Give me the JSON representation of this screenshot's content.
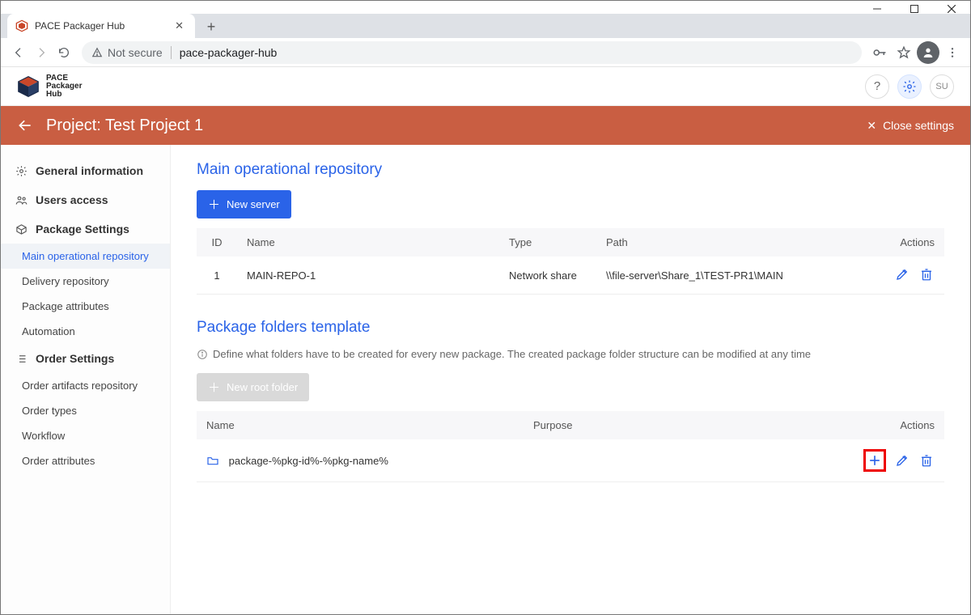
{
  "window": {
    "tab_title": "PACE Packager Hub",
    "not_secure_label": "Not secure",
    "url": "pace-packager-hub"
  },
  "app_header": {
    "logo_l1": "PACE",
    "logo_l2": "Packager",
    "logo_l3": "Hub",
    "user_badge": "SU"
  },
  "project_bar": {
    "title": "Project: Test Project 1",
    "close_label": "Close settings"
  },
  "sidebar": {
    "general": "General information",
    "users": "Users access",
    "pkg_settings": "Package Settings",
    "pkg_items": [
      "Main operational repository",
      "Delivery repository",
      "Package attributes",
      "Automation"
    ],
    "order_settings": "Order Settings",
    "order_items": [
      "Order artifacts repository",
      "Order types",
      "Workflow",
      "Order attributes"
    ]
  },
  "repo_section": {
    "title": "Main operational repository",
    "new_server_label": "New server",
    "columns": {
      "id": "ID",
      "name": "Name",
      "type": "Type",
      "path": "Path",
      "actions": "Actions"
    },
    "rows": [
      {
        "id": "1",
        "name": "MAIN-REPO-1",
        "type": "Network share",
        "path": "\\\\file-server\\Share_1\\TEST-PR1\\MAIN"
      }
    ]
  },
  "template_section": {
    "title": "Package folders template",
    "hint": "Define what folders have to be created for every new package. The created package folder structure can be modified at any time",
    "new_root_label": "New root folder",
    "columns": {
      "name": "Name",
      "purpose": "Purpose",
      "actions": "Actions"
    },
    "rows": [
      {
        "name": "package-%pkg-id%-%pkg-name%",
        "purpose": ""
      }
    ]
  }
}
